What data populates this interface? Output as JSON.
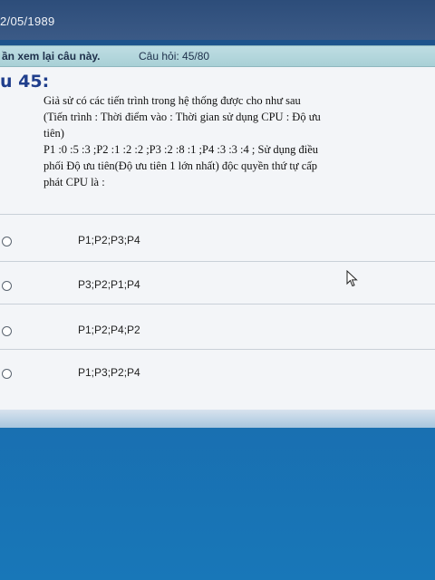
{
  "header": {
    "date": "2/05/1989"
  },
  "status": {
    "review_label": "ần xem lại câu này.",
    "question_counter": "Câu hỏi: 45/80"
  },
  "question": {
    "number_label": "u 45:",
    "text_lines": [
      "Giả sử có các tiến trình trong hệ thống được cho như sau",
      "(Tiến trình : Thời điểm vào : Thời gian sử dụng CPU : Độ ưu",
      "tiên)",
      "P1 :0 :5 :3 ;P2 :1 :2 :2 ;P3 :2 :8 :1 ;P4 :3 :3 :4 ; Sử dụng điều",
      "phối Độ ưu tiên(Độ ưu tiên 1 lớn nhất) độc quyền thứ tự cấp",
      "phát CPU là :"
    ]
  },
  "options": [
    {
      "label": "P1;P2;P3;P4"
    },
    {
      "label": "P3;P2;P1;P4"
    },
    {
      "label": "P1;P2;P4;P2"
    },
    {
      "label": "P1;P3;P2;P4"
    }
  ],
  "colors": {
    "question_number": "#1f3e8c",
    "status_bar": "#bfdde3",
    "page_background": "#f3f5f8",
    "desktop": "#1a66a8"
  }
}
